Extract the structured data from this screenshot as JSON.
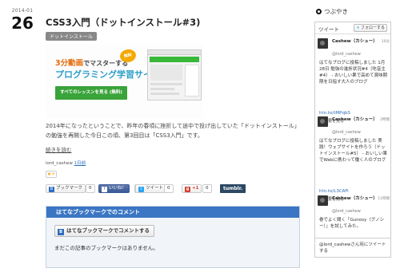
{
  "date": {
    "year_month": "2014-01",
    "day": "26"
  },
  "post": {
    "title": "CSS3入門（ドットインストール#3)",
    "tag": "ドットインストール",
    "banner": {
      "headline_accent": "3分動画",
      "headline_rest": "でマスターする",
      "badge": "無料",
      "subhead": "プログラミング学習サイト",
      "cta": "すべてのレッスンを見る (無料)"
    },
    "body": "2014年になったということで、昨年の春頃に挫折して途中で投げ出していた「ドットインストール」の勉強を再開した今日この頃、第3回目は「CSS3入門」です。",
    "read_more": "続きを読む",
    "author": "lord_cashew",
    "time_ago": "1日前",
    "star": "★+"
  },
  "share": {
    "hatena": "ブックマーク",
    "hatena_count": "0",
    "facebook": "いいね！",
    "facebook_count": "0",
    "tweet": "ツイート",
    "tweet_count": "0",
    "gplus": "+1",
    "gplus_count": "0",
    "tumblr": "tumblr."
  },
  "hatebu": {
    "header": "はてなブックマークでのコメント",
    "button": "はてなブックマークでコメントする",
    "empty": "まだこの記事のブックマークはありません。"
  },
  "sidebar": {
    "heading": "つぶやき",
    "widget_title": "ツイート",
    "follow": "フォローする",
    "tweets": [
      {
        "name": "Cashew（カシュー）",
        "time": "10分",
        "handle": "@lord_cashew",
        "text": "はてなブログに投稿しました 1月28日 勉強の進捗状況#4（吃音主#4） - おいしい果で高めて賞味期限を日指す大人のブログ",
        "link": "htn.to/tMPqbS",
        "detail": "概要を見る"
      },
      {
        "name": "Cashew（カシュー）",
        "time": "2時間",
        "handle": "@lord_cashew",
        "text": "はてなブログに投稿しました 実践！ウェブサイトを作ろう（ドットインストール#5） - おいしい果でWebに携わって働く人のブログ",
        "link": "htn.to/L3CAFi",
        "detail": "概要を見る"
      },
      {
        "name": "Cashew（カシュー）",
        "time": "11時間",
        "handle": "@lord_cashew",
        "text": "巻でよく聞く「Gunosy（グノシー）」を試してみた。"
      }
    ],
    "reply_prompt": "@lord_cashewさん宛にツイートする"
  },
  "colors": {
    "accent_blue": "#3b76c4",
    "cta_green": "#3aa33a",
    "banner_orange": "#e46d0e",
    "banner_blue": "#2c9fc9"
  }
}
